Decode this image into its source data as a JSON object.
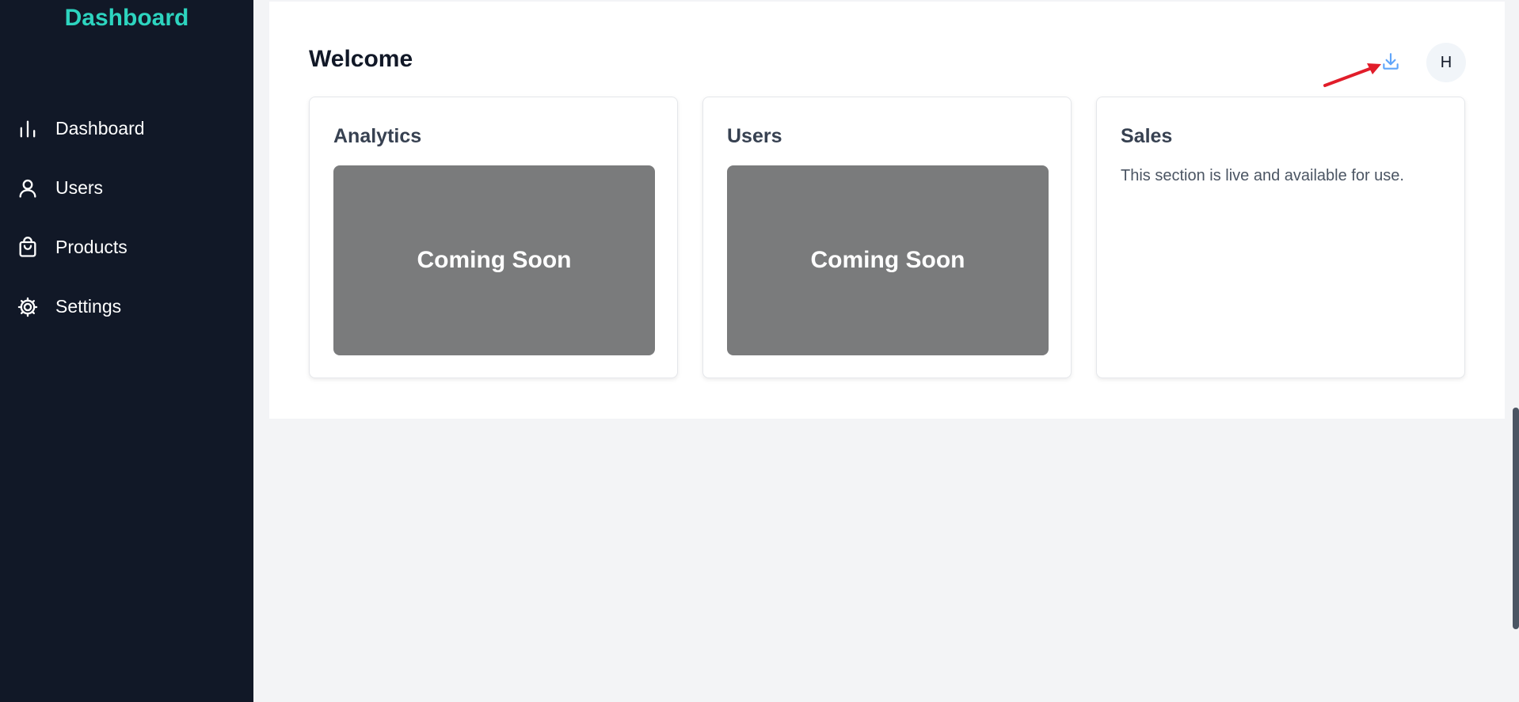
{
  "sidebar": {
    "brand": "Dashboard",
    "items": [
      {
        "label": "Dashboard",
        "icon": "bar-chart-icon"
      },
      {
        "label": "Users",
        "icon": "user-icon"
      },
      {
        "label": "Products",
        "icon": "shopping-bag-icon"
      },
      {
        "label": "Settings",
        "icon": "gear-icon"
      }
    ]
  },
  "header": {
    "title": "Welcome",
    "avatar_initial": "H"
  },
  "cards": [
    {
      "title": "Analytics",
      "placeholder": "Coming Soon"
    },
    {
      "title": "Users",
      "placeholder": "Coming Soon"
    },
    {
      "title": "Sales",
      "text": "This section is live and available for use."
    }
  ],
  "colors": {
    "sidebar_bg": "#111827",
    "brand": "#2dd4bf",
    "download_icon": "#60a5fa",
    "annotation_arrow": "#e11d2a",
    "placeholder_bg": "#7a7b7c"
  }
}
